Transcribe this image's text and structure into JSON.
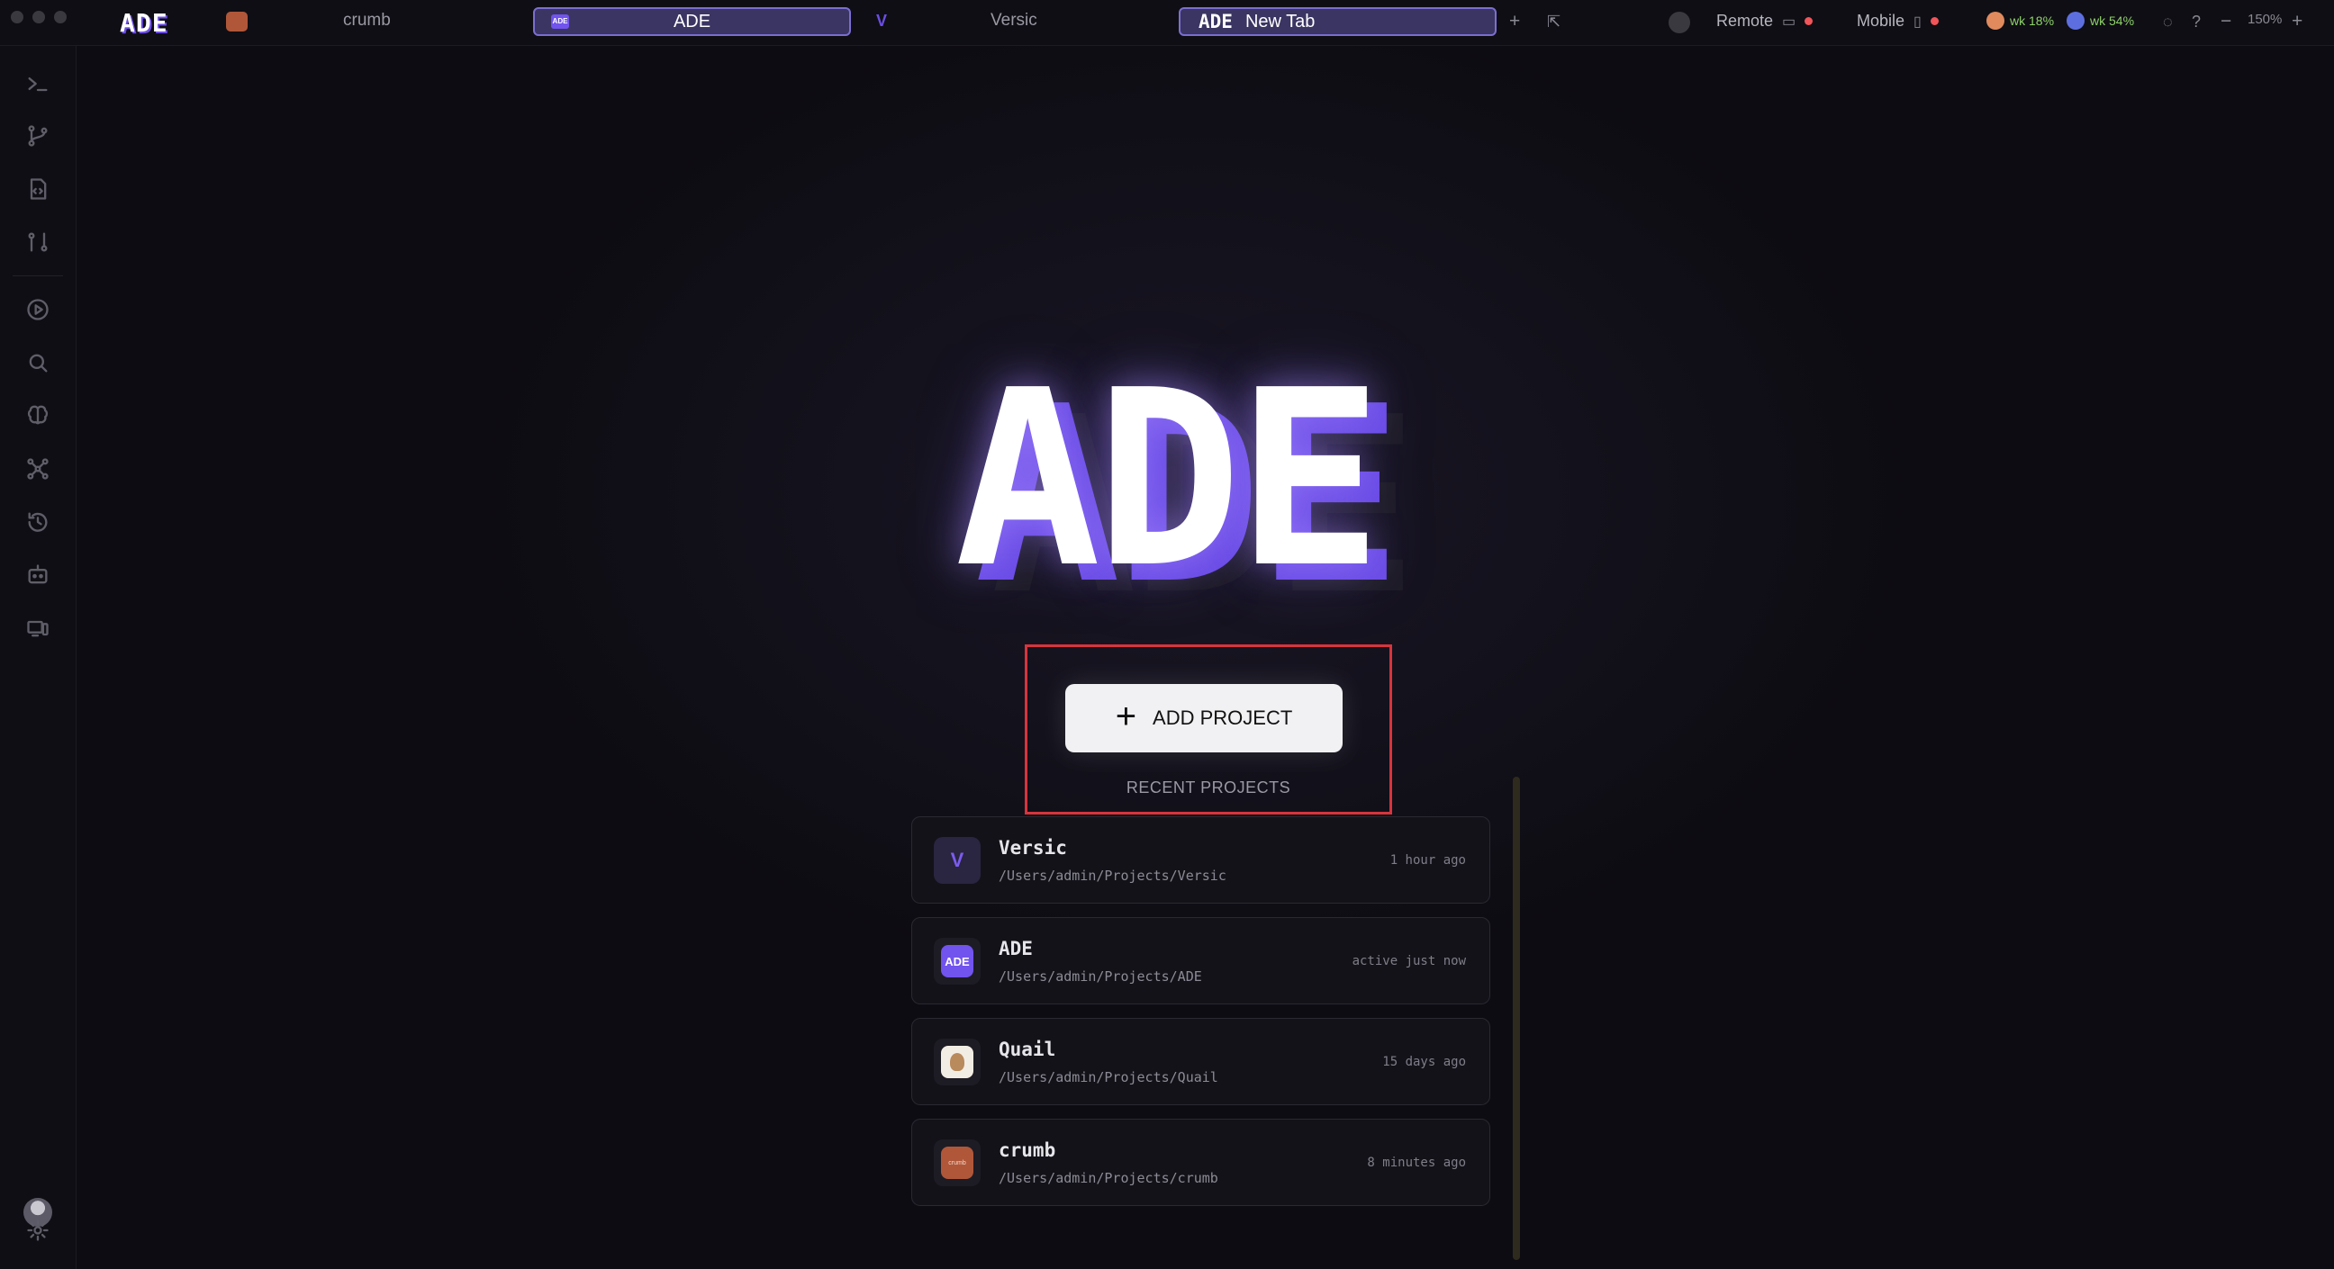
{
  "topbar": {
    "brand": "ADE",
    "tabs": [
      {
        "label": "crumb"
      },
      {
        "label": "ADE",
        "active": true
      },
      {
        "label": "Versic"
      },
      {
        "label": "New Tab",
        "logo": "ADE",
        "active": true
      }
    ],
    "remote_label": "Remote",
    "mobile_label": "Mobile",
    "usage_1": "wk 18%",
    "usage_2": "wk 54%",
    "zoom": "150%"
  },
  "sidebar": {
    "icons": [
      "terminal-icon",
      "git-branch-icon",
      "file-code-icon",
      "git-compare-icon",
      "play-icon",
      "search-icon",
      "brain-icon",
      "network-icon",
      "history-icon",
      "robot-icon",
      "devices-icon"
    ]
  },
  "hero": {
    "logo": "ADE"
  },
  "actions": {
    "add_project_label": "ADD PROJECT",
    "recent_label": "RECENT PROJECTS"
  },
  "projects": [
    {
      "name": "Versic",
      "path": "/Users/admin/Projects/Versic",
      "time": "1 hour ago",
      "icon_label": "V"
    },
    {
      "name": "ADE",
      "path": "/Users/admin/Projects/ADE",
      "time": "active just now",
      "icon_label": "ADE"
    },
    {
      "name": "Quail",
      "path": "/Users/admin/Projects/Quail",
      "time": "15 days ago",
      "icon_label": ""
    },
    {
      "name": "crumb",
      "path": "/Users/admin/Projects/crumb",
      "time": "8 minutes ago",
      "icon_label": "crumb"
    }
  ],
  "colors": {
    "accent": "#6b4de6",
    "status_red": "#f0555a",
    "usage_green": "#8ed36a",
    "highlight": "#d8343d"
  }
}
